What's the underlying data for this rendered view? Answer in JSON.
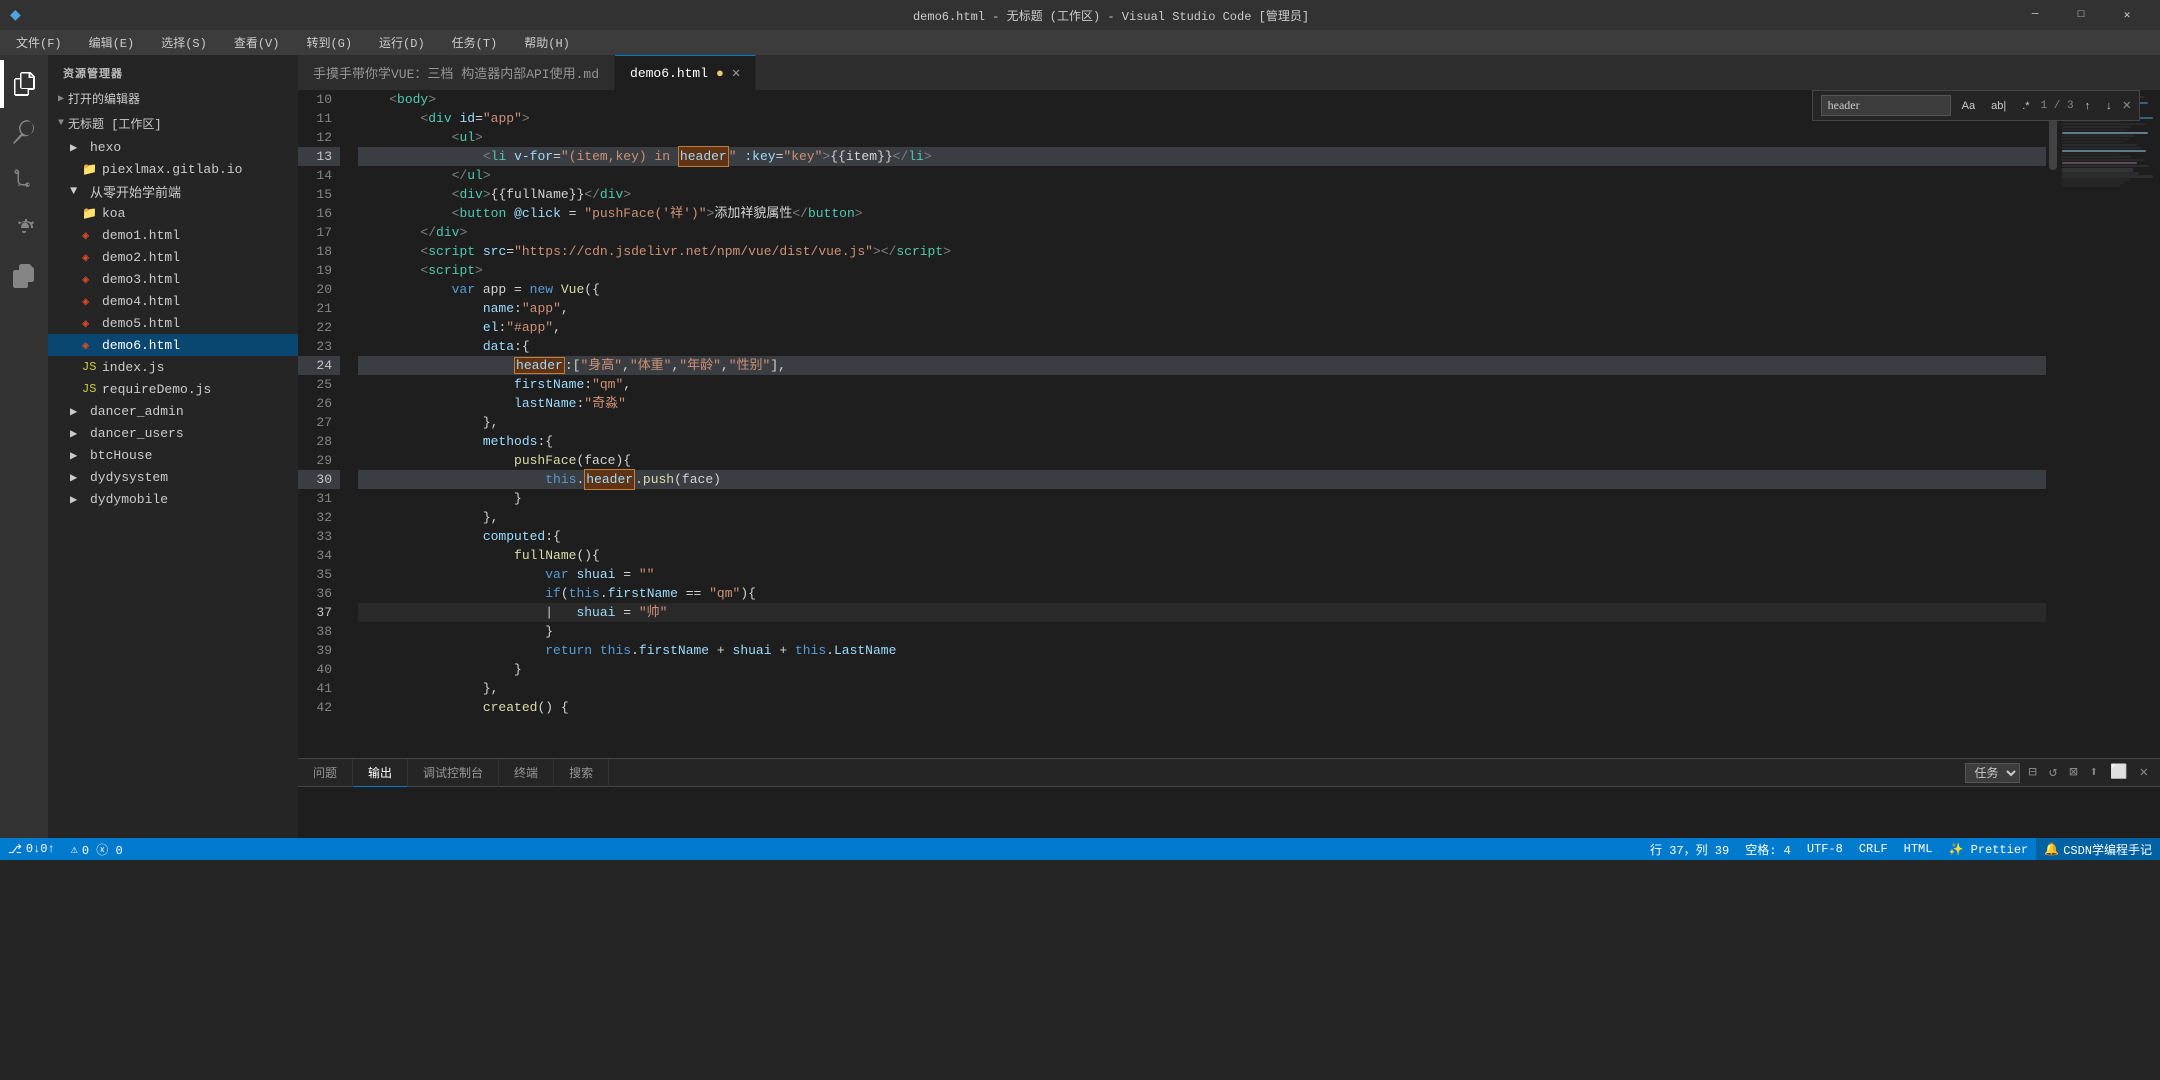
{
  "titleBar": {
    "title": "demo6.html - 无标题 (工作区) - Visual Studio Code [管理员]",
    "winControls": [
      "─",
      "□",
      "✕"
    ]
  },
  "menuBar": {
    "items": [
      "文件(F)",
      "编辑(E)",
      "选择(S)",
      "查看(V)",
      "转到(G)",
      "运行(D)",
      "任务(T)",
      "帮助(H)"
    ]
  },
  "sidebar": {
    "header": "资源管理器",
    "sections": [
      {
        "name": "打开的编辑器",
        "expanded": false
      },
      {
        "name": "无标题 [工作区]",
        "expanded": true
      }
    ],
    "tree": [
      {
        "label": "hexo",
        "indent": 1,
        "type": "folder",
        "expanded": true
      },
      {
        "label": "piexlmax.gitlab.io",
        "indent": 2,
        "type": "folder"
      },
      {
        "label": "从零开始学前端",
        "indent": 1,
        "type": "folder",
        "expanded": true
      },
      {
        "label": "koa",
        "indent": 2,
        "type": "folder"
      },
      {
        "label": "demo1.html",
        "indent": 2,
        "type": "html"
      },
      {
        "label": "demo2.html",
        "indent": 2,
        "type": "html"
      },
      {
        "label": "demo3.html",
        "indent": 2,
        "type": "html"
      },
      {
        "label": "demo4.html",
        "indent": 2,
        "type": "html"
      },
      {
        "label": "demo5.html",
        "indent": 2,
        "type": "html"
      },
      {
        "label": "demo6.html",
        "indent": 2,
        "type": "html",
        "active": true
      },
      {
        "label": "index.js",
        "indent": 2,
        "type": "js"
      },
      {
        "label": "requireDemo.js",
        "indent": 2,
        "type": "js"
      },
      {
        "label": "dancer_admin",
        "indent": 1,
        "type": "folder"
      },
      {
        "label": "dancer_users",
        "indent": 1,
        "type": "folder"
      },
      {
        "label": "btcHouse",
        "indent": 1,
        "type": "folder"
      },
      {
        "label": "dydysystem",
        "indent": 1,
        "type": "folder"
      },
      {
        "label": "dydymobile",
        "indent": 1,
        "type": "folder"
      }
    ]
  },
  "tabs": [
    {
      "label": "手摸手带你学VUE：三档 构造器内部API使用.md",
      "active": false,
      "modified": false
    },
    {
      "label": "demo6.html",
      "active": true,
      "modified": true
    }
  ],
  "findWidget": {
    "value": "header",
    "result": "1 / 3",
    "buttons": [
      "Aa",
      ".*",
      "\\b"
    ]
  },
  "codeLines": [
    {
      "num": 10,
      "content": "    <body>"
    },
    {
      "num": 11,
      "content": "        <div id=\"app\">"
    },
    {
      "num": 12,
      "content": "            <ul>"
    },
    {
      "num": 13,
      "content": "                <li v-for=\"(item,key) in ",
      "special": "header_highlight",
      "rest": " :key=\"key\">{{item}}</li>"
    },
    {
      "num": 14,
      "content": "            </ul>"
    },
    {
      "num": 15,
      "content": "            <div>{{fullName}}</div>"
    },
    {
      "num": 16,
      "content": "            <button @click = \"pushFace('祥')\">添加祥貌属性</button>"
    },
    {
      "num": 17,
      "content": "        </div>"
    },
    {
      "num": 18,
      "content": "        <script src=\"https://cdn.jsdelivr.net/npm/vue/dist/vue.js\"></",
      "scriptTag": true
    },
    {
      "num": 19,
      "content": "        <script>"
    },
    {
      "num": 20,
      "content": "            var app = new Vue({"
    },
    {
      "num": 21,
      "content": "                name:\"app\","
    },
    {
      "num": 22,
      "content": "                el:\"#app\","
    },
    {
      "num": 23,
      "content": "                data:{"
    },
    {
      "num": 24,
      "content": "                    header:[\"身高\",\"体重\",\"年龄\",\"性别\"],"
    },
    {
      "num": 25,
      "content": "                    firstName:\"qm\","
    },
    {
      "num": 26,
      "content": "                    lastName:\"奇淼\""
    },
    {
      "num": 27,
      "content": "                },"
    },
    {
      "num": 28,
      "content": "                methods:{"
    },
    {
      "num": 29,
      "content": "                    pushFace(face){"
    },
    {
      "num": 30,
      "content": "                        this.header.push(face)"
    },
    {
      "num": 31,
      "content": "                    }"
    },
    {
      "num": 32,
      "content": "                },"
    },
    {
      "num": 33,
      "content": "                computed:{"
    },
    {
      "num": 34,
      "content": "                    fullName(){"
    },
    {
      "num": 35,
      "content": "                        var shuai = \"\""
    },
    {
      "num": 36,
      "content": "                        if(this.firstName == \"qm\"){"
    },
    {
      "num": 37,
      "content": "                        |   shuai = \"帅\"",
      "current": true
    },
    {
      "num": 38,
      "content": "                        }"
    },
    {
      "num": 39,
      "content": "                        return this.firstName + shuai + this.lastName"
    },
    {
      "num": 40,
      "content": "                    }"
    },
    {
      "num": 41,
      "content": "                },"
    },
    {
      "num": 42,
      "content": "                created() {"
    }
  ],
  "panel": {
    "tabs": [
      "问题",
      "输出",
      "调试控制台",
      "终端",
      "搜索"
    ],
    "activeTab": "输出",
    "taskDropdown": "任务"
  },
  "statusBar": {
    "left": [
      {
        "icon": "⎇",
        "text": "0↓0↑"
      },
      {
        "icon": "",
        "text": "⚠ 0  ⓧ 0"
      }
    ],
    "right": [
      {
        "text": "行 37，列 39"
      },
      {
        "text": "空格: 4"
      },
      {
        "text": "UTF-8"
      },
      {
        "text": "CRLF"
      },
      {
        "text": "HTML"
      },
      {
        "text": "Prettier"
      },
      {
        "text": "CSDN学编程手记"
      }
    ]
  },
  "colors": {
    "activityBar": "#333333",
    "sidebar": "#252526",
    "editor": "#1e1e1e",
    "tabActive": "#1e1e1e",
    "tabInactive": "#2d2d2d",
    "statusBar": "#007acc",
    "accent": "#007acc"
  }
}
